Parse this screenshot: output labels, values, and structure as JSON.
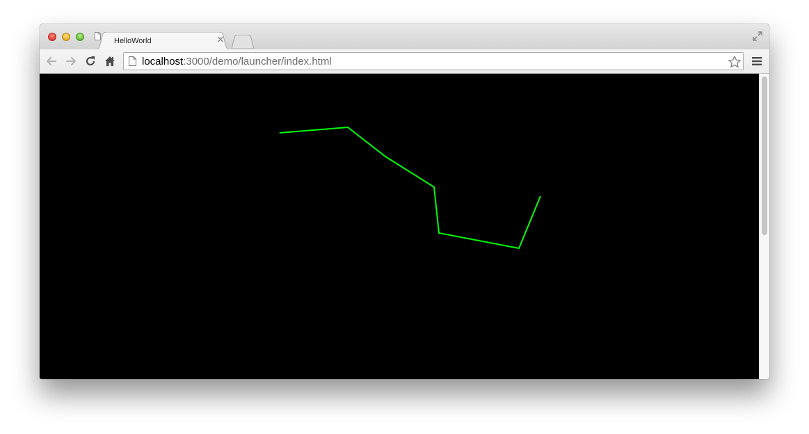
{
  "browser": {
    "tab_title": "HelloWorld",
    "url_host": "localhost",
    "url_rest": ":3000/demo/launcher/index.html",
    "icons": {
      "back": "back-arrow-icon",
      "forward": "forward-arrow-icon",
      "reload": "reload-icon",
      "home": "home-icon",
      "page": "page-icon",
      "bookmark": "star-icon",
      "menu": "hamburger-menu-icon",
      "fullscreen": "fullscreen-icon",
      "close_tab": "close-icon"
    }
  },
  "content": {
    "background_color": "#000000",
    "line_color": "#00ff00"
  }
}
